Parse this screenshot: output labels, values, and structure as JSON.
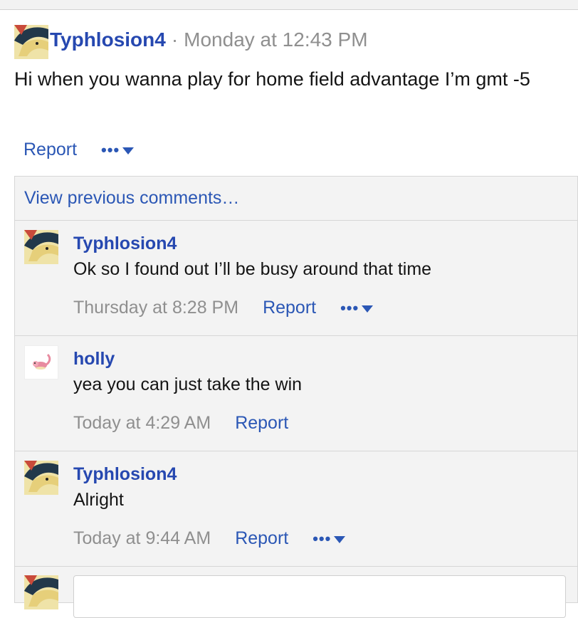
{
  "post": {
    "author": "Typhlosion4",
    "separator": "·",
    "time": "Monday at 12:43 PM",
    "body": "Hi when you wanna play for home field advantage I’m gmt -5",
    "report_label": "Report",
    "menu_dots": "•••"
  },
  "comments": {
    "view_previous": "View previous comments…",
    "items": [
      {
        "author": "Typhlosion4",
        "text": "Ok so I found out I’ll be busy around that time",
        "time": "Thursday at 8:28 PM",
        "report_label": "Report",
        "menu_dots": "•••",
        "avatar": "typhlosion-avatar"
      },
      {
        "author": "holly",
        "text": "yea you can just take the win",
        "time": "Today at 4:29 AM",
        "report_label": "Report",
        "avatar": "slowpoke-avatar"
      },
      {
        "author": "Typhlosion4",
        "text": "Alright",
        "time": "Today at 9:44 AM",
        "report_label": "Report",
        "menu_dots": "•••",
        "avatar": "typhlosion-avatar"
      }
    ],
    "reply_placeholder": ""
  },
  "colors": {
    "link": "#2b57b5",
    "username": "#2648b0",
    "muted": "#8f8f8f",
    "comment_bg": "#f3f3f3",
    "border": "#d6d6d6"
  }
}
